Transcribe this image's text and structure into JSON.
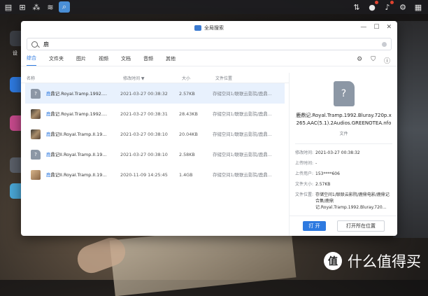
{
  "taskbar": {
    "icons": [
      "menu-icon",
      "grid-icon",
      "cloud-share-icon",
      "network-icon",
      "search-app-icon"
    ],
    "right_icons": [
      "sort-icon",
      "user-icon",
      "notification-icon",
      "settings-icon",
      "grid-menu-icon"
    ]
  },
  "window": {
    "title": "全局搜索",
    "controls": {
      "minimize": "—",
      "maximize": "☐",
      "close": "✕"
    }
  },
  "search": {
    "value": "鹿",
    "placeholder": ""
  },
  "tabs": [
    "综合",
    "文件夹",
    "图片",
    "视频",
    "文档",
    "音频",
    "其他"
  ],
  "active_tab": "综合",
  "columns": {
    "name": "名称",
    "date": "修改时间",
    "size": "大小",
    "location": "文件位置"
  },
  "rows": [
    {
      "prefix": "鹿",
      "rest": "鼎记.Royal.Tramp.1992....",
      "date": "2021-03-27 00:38:32",
      "size": "2.57KB",
      "location": "存储空间1/联联云影院/鹿鼎...",
      "thumb": "file",
      "selected": true
    },
    {
      "prefix": "鹿",
      "rest": "鼎记.Royal.Tramp.1992....",
      "date": "2021-03-27 00:38:31",
      "size": "28.43KB",
      "location": "存储空间1/联联云影院/鹿鼎...",
      "thumb": "img1",
      "selected": false
    },
    {
      "prefix": "鹿",
      "rest": "鼎记II.Royal.Tramp.II.19...",
      "date": "2021-03-27 00:38:10",
      "size": "20.04KB",
      "location": "存储空间1/联联云影院/鹿鼎...",
      "thumb": "img1",
      "selected": false
    },
    {
      "prefix": "鹿",
      "rest": "鼎记II.Royal.Tramp.II.19...",
      "date": "2021-03-27 00:38:10",
      "size": "2.58KB",
      "location": "存储空间1/联联云影院/鹿鼎...",
      "thumb": "file",
      "selected": false
    },
    {
      "prefix": "鹿",
      "rest": "鼎记II.Royal.Tramp.II.19...",
      "date": "2020-11-09 14:25:45",
      "size": "1.4GB",
      "location": "存储空间1/联联云影院/鹿鼎...",
      "thumb": "img2",
      "selected": false
    }
  ],
  "detail": {
    "file_name": "鹿鼎记.Royal.Tramp.1992.Bluray.720p.x265.AAC(5.1).2Audios.GREENOTEA.nfo",
    "file_type": "文件",
    "props": [
      {
        "k": "修改时间:",
        "v": "2021-03-27 00:38:32"
      },
      {
        "k": "上传时间:",
        "v": "-"
      },
      {
        "k": "上传用户:",
        "v": "153****606"
      },
      {
        "k": "文件大小:",
        "v": "2.57KB"
      },
      {
        "k": "文件位置:",
        "v": "存储空间1/联联云影院/鹿鼎电影/鹿鼎记合集/鹿鼎记.Royal.Tramp.1992.Bluray.720..."
      }
    ],
    "open_button": "打 开",
    "open_location_button": "打开所在位置"
  },
  "desktop": {
    "label": "设"
  },
  "watermark": {
    "logo": "值",
    "text": "什么值得买"
  }
}
